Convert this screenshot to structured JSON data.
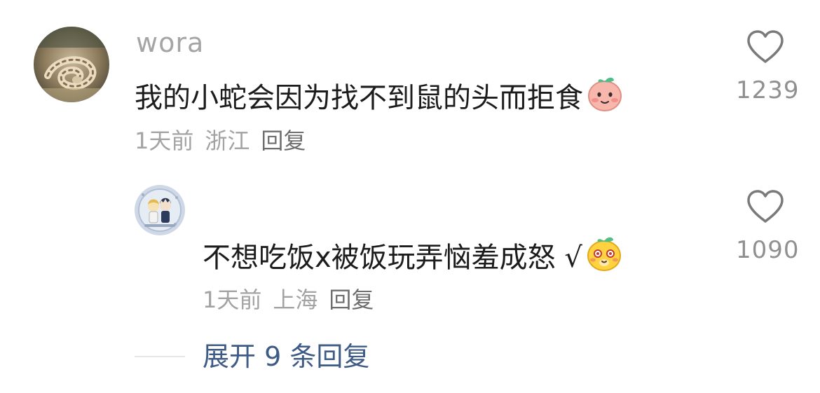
{
  "comment": {
    "username": "wora",
    "text": "我的小蛇会因为找不到鼠的头而拒食",
    "emoji_icon": "shy-pink-face-emoji",
    "time": "1天前",
    "location": "浙江",
    "reply_label": "回复",
    "likes": "1239"
  },
  "reply": {
    "text": "不想吃饭x被饭玩弄恼羞成怒 √",
    "emoji_icon": "smiling-yellow-face-emoji",
    "time": "1天前",
    "location": "上海",
    "reply_label": "回复",
    "likes": "1090"
  },
  "expand": {
    "label": "展开 9 条回复"
  },
  "colors": {
    "text": "#1c1c1c",
    "meta": "#a3a3a3",
    "link": "#3e5a86",
    "heart": "#7a7a7a"
  }
}
